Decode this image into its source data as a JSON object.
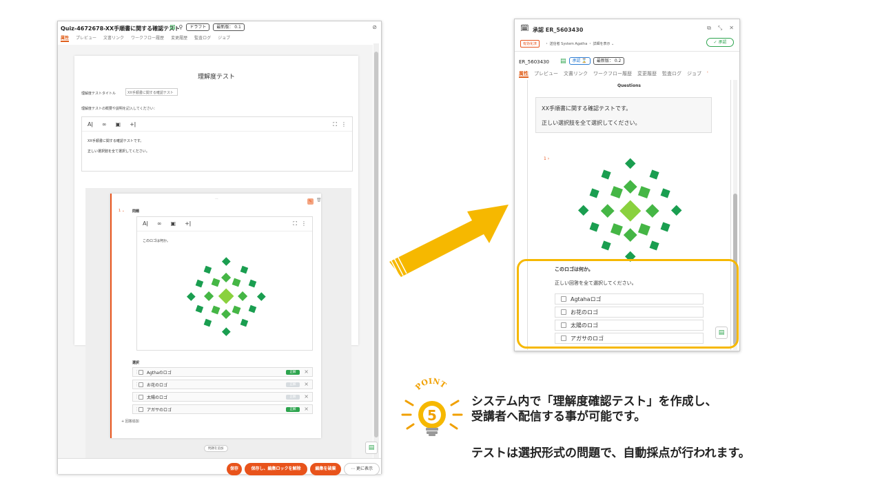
{
  "left": {
    "title": "Quiz-4672678-XX手順書に関する確認テスト",
    "draft_tag": "ドラフト",
    "latest_tag": "最新版： 0.1",
    "tabs": [
      "属性",
      "プレビュー",
      "文書リンク",
      "ワークフロー履歴",
      "変更履歴",
      "監査ログ",
      "ジョブ"
    ],
    "heading": "理解度テスト",
    "title_label": "理解度テストタイトル",
    "title_value": "XX手順書に関する確認テスト",
    "desc_label": "理解度テストの概要や説明を記入してください：",
    "toolbar": {
      "ai": "Aǀ",
      "link": "∞",
      "img": "▣",
      "plus": "+ǀ",
      "expand": "⛶",
      "more": "⋮"
    },
    "desc_line1": "XX手順書に関する確認テストです。",
    "desc_line2": "正しい選択肢を全て選択してください。",
    "q_number": "1",
    "q_label": "問題",
    "q_text": "このロゴは何か。",
    "options_label": "選択",
    "options": [
      {
        "text": "Agthaのロゴ",
        "correct": "正解"
      },
      {
        "text": "お花のロゴ",
        "correct": "正解"
      },
      {
        "text": "太陽のロゴ",
        "correct": "正解"
      },
      {
        "text": "アガサのロゴ",
        "correct": "正解"
      }
    ],
    "add_option": "+ 回答追加",
    "add_question": "問題を追加",
    "buttons": {
      "save": "保存",
      "save_unlock": "保存し、編集ロックを解除",
      "discard": "編集を破棄",
      "more": "⋯ 更に表示"
    }
  },
  "right": {
    "window_title": "承認 ER_5603430",
    "status_badge": "有効化済",
    "sender": "・ 送信者 System Agatha ・ 詳細を表示 ⌄",
    "approve_button": "✓ 承認",
    "doc_id": "ER_5603430",
    "approve_tag": "承認 ⌛",
    "latest_tag": "最新版： 0.2",
    "tabs": [
      "属性",
      "プレビュー",
      "文書リンク",
      "ワークフロー履歴",
      "変更履歴",
      "監査ログ",
      "ジョブ",
      "ʿ"
    ],
    "section_title": "Questions",
    "desc_line1": "XX手順書に関する確認テストです。",
    "desc_line2": "正しい選択肢を全て選択してください。",
    "q_number": "1",
    "q_text": "このロゴは何か。",
    "q_instruction": "正しい回答を全て選択してください。",
    "options": [
      "Agtahaロゴ",
      "お花のロゴ",
      "太陽のロゴ",
      "アガサのロゴ"
    ]
  },
  "point": {
    "label": "POINT",
    "number": "5"
  },
  "text": {
    "line1": "システム内で「理解度確認テスト」を作成し、",
    "line2": "受講者へ配信する事が可能です。",
    "line3": "テストは選択形式の問題で、自動採点が行われます。"
  },
  "colors": {
    "accent": "#e8531b",
    "arrow": "#f6b800",
    "logo": "#1a9e50",
    "logo_light": "#7fcf3a"
  }
}
